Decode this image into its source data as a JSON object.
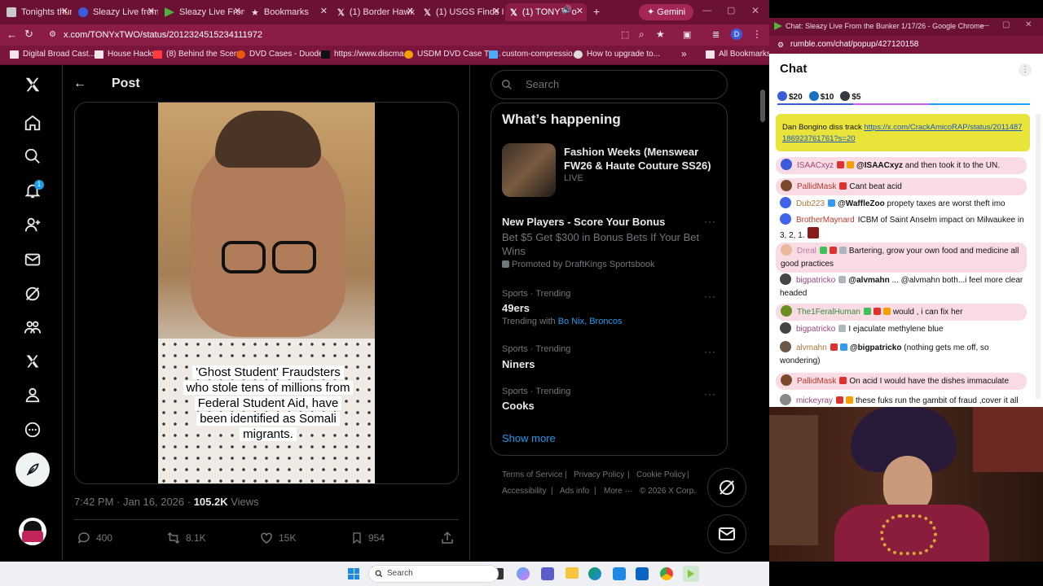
{
  "browser": {
    "tabs": [
      {
        "label": "Tonights thumbn",
        "icon_color": "#c9c9c9"
      },
      {
        "label": "Sleazy Live from",
        "icon_color": "#3b5bdb"
      },
      {
        "label": "Sleazy Live From",
        "icon_color": "#52b043"
      },
      {
        "label": "Bookmarks",
        "icon_color": "#f1d9e2"
      },
      {
        "label": "(1) Border Hawk",
        "icon_color": "#f1d9e2"
      },
      {
        "label": "(1) USGS Finds I",
        "icon_color": "#f1d9e2"
      },
      {
        "label": "(1) TONY™ o",
        "icon_color": "#f1d9e2"
      }
    ],
    "new_tab": "+",
    "gemini_label": "Gemini",
    "url": "x.com/TONYxTWO/status/2012324515234111972",
    "profile_initial": "D",
    "bookmarks": [
      "Digital Broad Cast...",
      "House Hacks",
      "(8) Behind the Scen...",
      "DVD Cases - Duode...",
      "https://www.discma...",
      "USDM DVD Case Tw...",
      "custom-compressio...",
      "How to upgrade to..."
    ],
    "more_bookmarks": "»",
    "all_bookmarks": "All Bookmarks"
  },
  "x": {
    "header_title": "Post",
    "notifications_count": "1",
    "caption": "'Ghost Student' Fraudsters who stole tens of millions from Federal Student Aid, have been identified as Somali migrants.",
    "time": "7:42 PM · Jan 16, 2026 · ",
    "views_count": "105.2K",
    "views_label": " Views",
    "actions": {
      "replies": "400",
      "reposts": "8.1K",
      "likes": "15K",
      "bookmarks": "954"
    },
    "search_placeholder": "Search",
    "happening_title": "What’s happening",
    "trends": [
      {
        "kind": "event",
        "title": "Fashion Weeks (Menswear FW26 & Haute Couture SS26)",
        "status": "LIVE"
      },
      {
        "kind": "ad",
        "title": "New Players - Score Your Bonus",
        "body": "Bet $5 Get $300 in Bonus Bets If Your Bet Wins",
        "promoted": "Promoted by DraftKings Sportsbook"
      },
      {
        "kind": "trend",
        "category": "Sports · Trending",
        "title": "49ers",
        "with_label": "Trending with ",
        "with": "Bo Nix, Broncos"
      },
      {
        "kind": "trend",
        "category": "Sports · Trending",
        "title": "Niners"
      },
      {
        "kind": "trend",
        "category": "Sports · Trending",
        "title": "Cooks"
      }
    ],
    "show_more": "Show more",
    "footer": [
      "Terms of Service",
      "|",
      "Privacy Policy",
      "|",
      "Cookie Policy",
      "|",
      "Accessibility",
      "|",
      "Ads info",
      "|",
      "More ···",
      "© 2026 X Corp."
    ]
  },
  "chat": {
    "window_title": "Chat: Sleazy Live From the Bunker 1/17/26 - Google Chrome",
    "url": "rumble.com/chat/popup/427120158",
    "heading": "Chat",
    "rants": [
      {
        "amount": "$20",
        "color": "#3b5bdb"
      },
      {
        "amount": "$10",
        "color": "#1971c2"
      },
      {
        "amount": "$5",
        "color": "#343a40"
      }
    ],
    "pinned": {
      "prefix": "Dan Bongino diss track ",
      "link": "https://x.com/CrackAmicoRAP/status/2011487186923761761?s=20"
    },
    "messages": [
      {
        "user": "ISAACxyz",
        "mention": "@ISAACxyz",
        "text": " and then took it to the UN.",
        "user_color": "#a0457a",
        "pink": true
      },
      {
        "user": "PallidMask",
        "mention": "",
        "text": "Cant beat acid",
        "user_color": "#c0392b",
        "pink": true
      },
      {
        "user": "Dub223",
        "mention": "@WaffleZoo",
        "text": " propety taxes are worst theft imo",
        "user_color": "#b0753a",
        "pink": false
      },
      {
        "user": "BrotherMaynard",
        "mention": "",
        "text": "ICBM of Saint Anselm impact on Milwaukee in 3, 2, 1.",
        "user_color": "#c0392b",
        "pink": false
      },
      {
        "user": "Dreal",
        "mention": "",
        "text": "Bartering, grow your own food and medicine all good practices",
        "user_color": "#c07aa0",
        "pink": true
      },
      {
        "user": "bigpatricko",
        "mention": "@alvmahn",
        "text": " ... @alvmahn both...i feel more clear headed",
        "user_color": "#a0457a",
        "pink": false
      },
      {
        "user": "The1FeralHuman",
        "mention": "",
        "text": "would , i can fix her",
        "user_color": "#3a8a3a",
        "pink": true
      },
      {
        "user": "bigpatricko",
        "mention": "",
        "text": "I ejaculate methylene blue",
        "user_color": "#a0457a",
        "pink": false
      },
      {
        "user": "alvmahn",
        "mention": "@bigpatricko",
        "text": " (nothing gets me off, so wondering)",
        "user_color": "#b0753a",
        "pink": false
      },
      {
        "user": "PallidMask",
        "mention": "",
        "text": "On acid I would have the dishes immaculate",
        "user_color": "#c0392b",
        "pink": true
      },
      {
        "user": "mickeyray",
        "mention": "",
        "text": "these fuks run the gambit of fraud ,cover it all",
        "user_color": "#a0457a",
        "pink": false
      }
    ]
  },
  "taskbar": {
    "search_label": "Search"
  }
}
